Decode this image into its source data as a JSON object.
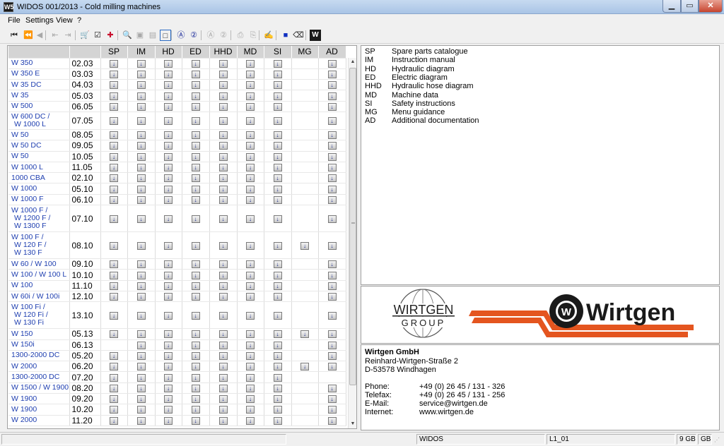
{
  "window": {
    "title": "WIDOS 001/2013 - Cold milling machines",
    "app_icon": "W5"
  },
  "menu": [
    "File",
    "Settings",
    "View",
    "?"
  ],
  "toolbar": {
    "icons": [
      {
        "name": "first-icon",
        "glyph": "⏮",
        "enabled": true
      },
      {
        "name": "back-back-icon",
        "glyph": "⏪",
        "enabled": false
      },
      {
        "name": "back-icon",
        "glyph": "◀",
        "enabled": false
      },
      {
        "name": "page-prev-icon",
        "glyph": "⇤",
        "enabled": false
      },
      {
        "name": "page-next-icon",
        "glyph": "⇥",
        "enabled": false
      },
      {
        "name": "cart-icon",
        "glyph": "🛒",
        "enabled": true
      },
      {
        "name": "checklist-icon",
        "glyph": "☑",
        "enabled": true
      },
      {
        "name": "medical-cross-icon",
        "glyph": "✚",
        "enabled": true
      },
      {
        "name": "zoom-icon",
        "glyph": "🔍",
        "enabled": false
      },
      {
        "name": "fit-page-icon",
        "glyph": "▣",
        "enabled": false
      },
      {
        "name": "fit-width-icon",
        "glyph": "▤",
        "enabled": false
      },
      {
        "name": "frame-icon",
        "glyph": "□",
        "enabled": true
      },
      {
        "name": "circle-a-icon",
        "glyph": "Ⓐ",
        "enabled": true
      },
      {
        "name": "circle-2-icon",
        "glyph": "②",
        "enabled": true
      },
      {
        "name": "circle-a-gray-icon",
        "glyph": "Ⓐ",
        "enabled": false
      },
      {
        "name": "circle-2-gray-icon",
        "glyph": "②",
        "enabled": false
      },
      {
        "name": "print-icon",
        "glyph": "⎙",
        "enabled": false
      },
      {
        "name": "print-setup-icon",
        "glyph": "⎘",
        "enabled": false
      },
      {
        "name": "stamp-icon",
        "glyph": "✍",
        "enabled": false
      },
      {
        "name": "blue-square-icon",
        "glyph": "■",
        "enabled": true
      },
      {
        "name": "eraser-icon",
        "glyph": "⌫",
        "enabled": true
      },
      {
        "name": "widos-icon",
        "glyph": "W",
        "enabled": true
      }
    ]
  },
  "grid": {
    "columns": [
      "SP",
      "IM",
      "HD",
      "ED",
      "HHD",
      "MD",
      "SI",
      "MG",
      "AD"
    ],
    "download_icon": "↓",
    "rows": [
      {
        "model": [
          "W 350"
        ],
        "version": "02.03",
        "docs": [
          1,
          1,
          1,
          1,
          1,
          1,
          1,
          0,
          1
        ]
      },
      {
        "model": [
          "W 350 E"
        ],
        "version": "03.03",
        "docs": [
          1,
          1,
          1,
          1,
          1,
          1,
          1,
          0,
          1
        ]
      },
      {
        "model": [
          "W 35 DC"
        ],
        "version": "04.03",
        "docs": [
          1,
          1,
          1,
          1,
          1,
          1,
          1,
          0,
          1
        ]
      },
      {
        "model": [
          "W 35"
        ],
        "version": "05.03",
        "docs": [
          1,
          1,
          1,
          1,
          1,
          1,
          1,
          0,
          1
        ]
      },
      {
        "model": [
          "W 500"
        ],
        "version": "06.05",
        "docs": [
          1,
          1,
          1,
          1,
          1,
          1,
          1,
          0,
          1
        ]
      },
      {
        "model": [
          "W 600 DC /",
          "W 1000 L"
        ],
        "version": "07.05",
        "docs": [
          1,
          1,
          1,
          1,
          1,
          1,
          1,
          0,
          1
        ]
      },
      {
        "model": [
          "W 50"
        ],
        "version": "08.05",
        "docs": [
          1,
          1,
          1,
          1,
          1,
          1,
          1,
          0,
          1
        ]
      },
      {
        "model": [
          "W 50 DC"
        ],
        "version": "09.05",
        "docs": [
          1,
          1,
          1,
          1,
          1,
          1,
          1,
          0,
          1
        ]
      },
      {
        "model": [
          "W 50"
        ],
        "version": "10.05",
        "docs": [
          1,
          1,
          1,
          1,
          1,
          1,
          1,
          0,
          1
        ]
      },
      {
        "model": [
          "W 1000 L"
        ],
        "version": "11.05",
        "docs": [
          1,
          1,
          1,
          1,
          1,
          1,
          1,
          0,
          1
        ]
      },
      {
        "model": [
          "1000 CBA"
        ],
        "version": "02.10",
        "docs": [
          1,
          1,
          1,
          1,
          1,
          1,
          1,
          0,
          1
        ]
      },
      {
        "model": [
          "W 1000"
        ],
        "version": "05.10",
        "docs": [
          1,
          1,
          1,
          1,
          1,
          1,
          1,
          0,
          1
        ]
      },
      {
        "model": [
          "W 1000 F"
        ],
        "version": "06.10",
        "docs": [
          1,
          1,
          1,
          1,
          1,
          1,
          1,
          0,
          1
        ]
      },
      {
        "model": [
          "W 1000 F /",
          "W 1200 F /",
          "W 1300 F"
        ],
        "version": "07.10",
        "docs": [
          1,
          1,
          1,
          1,
          1,
          1,
          1,
          0,
          1
        ]
      },
      {
        "model": [
          "W 100 F /",
          "W 120 F /",
          "W 130 F"
        ],
        "version": "08.10",
        "docs": [
          1,
          1,
          1,
          1,
          1,
          1,
          1,
          1,
          1
        ]
      },
      {
        "model": [
          "W 60 / W 100"
        ],
        "version": "09.10",
        "docs": [
          1,
          1,
          1,
          1,
          1,
          1,
          1,
          0,
          1
        ]
      },
      {
        "model": [
          "W 100 / W 100 L"
        ],
        "version": "10.10",
        "docs": [
          1,
          1,
          1,
          1,
          1,
          1,
          1,
          0,
          1
        ]
      },
      {
        "model": [
          "W 100"
        ],
        "version": "11.10",
        "docs": [
          1,
          1,
          1,
          1,
          1,
          1,
          1,
          0,
          1
        ]
      },
      {
        "model": [
          "W 60i / W 100i"
        ],
        "version": "12.10",
        "docs": [
          1,
          1,
          1,
          1,
          1,
          1,
          1,
          0,
          1
        ]
      },
      {
        "model": [
          "W 100 Fi /",
          "W 120 Fi /",
          "W 130 Fi"
        ],
        "version": "13.10",
        "docs": [
          1,
          1,
          1,
          1,
          1,
          1,
          1,
          0,
          1
        ]
      },
      {
        "model": [
          "W 150"
        ],
        "version": "05.13",
        "docs": [
          1,
          1,
          1,
          1,
          1,
          1,
          1,
          1,
          1
        ]
      },
      {
        "model": [
          "W 150i"
        ],
        "version": "06.13",
        "docs": [
          0,
          1,
          1,
          1,
          1,
          1,
          1,
          0,
          1
        ]
      },
      {
        "model": [
          "1300-2000 DC"
        ],
        "version": "05.20",
        "docs": [
          1,
          1,
          1,
          1,
          1,
          1,
          1,
          0,
          1
        ]
      },
      {
        "model": [
          "W 2000"
        ],
        "version": "06.20",
        "docs": [
          1,
          1,
          1,
          1,
          1,
          1,
          1,
          1,
          1
        ]
      },
      {
        "model": [
          "1300-2000 DC"
        ],
        "version": "07.20",
        "docs": [
          1,
          1,
          1,
          1,
          1,
          1,
          1,
          0,
          0
        ]
      },
      {
        "model": [
          "W 1500 / W 1900"
        ],
        "version": "08.20",
        "docs": [
          1,
          1,
          1,
          1,
          1,
          1,
          1,
          0,
          1
        ]
      },
      {
        "model": [
          "W 1900"
        ],
        "version": "09.20",
        "docs": [
          1,
          1,
          1,
          1,
          1,
          1,
          1,
          0,
          1
        ]
      },
      {
        "model": [
          "W 1900"
        ],
        "version": "10.20",
        "docs": [
          1,
          1,
          1,
          1,
          1,
          1,
          1,
          0,
          1
        ]
      },
      {
        "model": [
          "W 2000"
        ],
        "version": "11.20",
        "docs": [
          1,
          1,
          1,
          1,
          1,
          1,
          1,
          0,
          1
        ]
      }
    ]
  },
  "legend": [
    {
      "abbr": "SP",
      "desc": "Spare parts catalogue"
    },
    {
      "abbr": "IM",
      "desc": "Instruction manual"
    },
    {
      "abbr": "HD",
      "desc": "Hydraulic diagram"
    },
    {
      "abbr": "ED",
      "desc": "Electric diagram"
    },
    {
      "abbr": "HHD",
      "desc": "Hydraulic hose diagram"
    },
    {
      "abbr": "MD",
      "desc": "Machine data"
    },
    {
      "abbr": "SI",
      "desc": "Safety instructions"
    },
    {
      "abbr": "MG",
      "desc": "Menu guidance"
    },
    {
      "abbr": "AD",
      "desc": "Additional documentation"
    }
  ],
  "logos": {
    "group_top": "WIRTGEN",
    "group_bottom": "GROUP",
    "brand": "Wirtgen",
    "brand_badge": "W"
  },
  "contact": {
    "company": "Wirtgen GmbH",
    "street": "Reinhard-Wirtgen-Straße 2",
    "city": "D-53578 Windhagen",
    "phone_label": "Phone:",
    "phone": "+49 (0) 26 45 / 131 - 326",
    "fax_label": "Telefax:",
    "fax": "+49 (0) 26 45 / 131 - 256",
    "email_label": "E-Mail:",
    "email": "service@wirtgen.de",
    "web_label": "Internet:",
    "web": "www.wirtgen.de"
  },
  "status": {
    "app": "WIDOS",
    "page": "L1_01",
    "disk_a": "9 GB",
    "disk_b": "GB"
  },
  "colors": {
    "model_link": "#1f3fb0",
    "brand_orange": "#e4551f"
  }
}
